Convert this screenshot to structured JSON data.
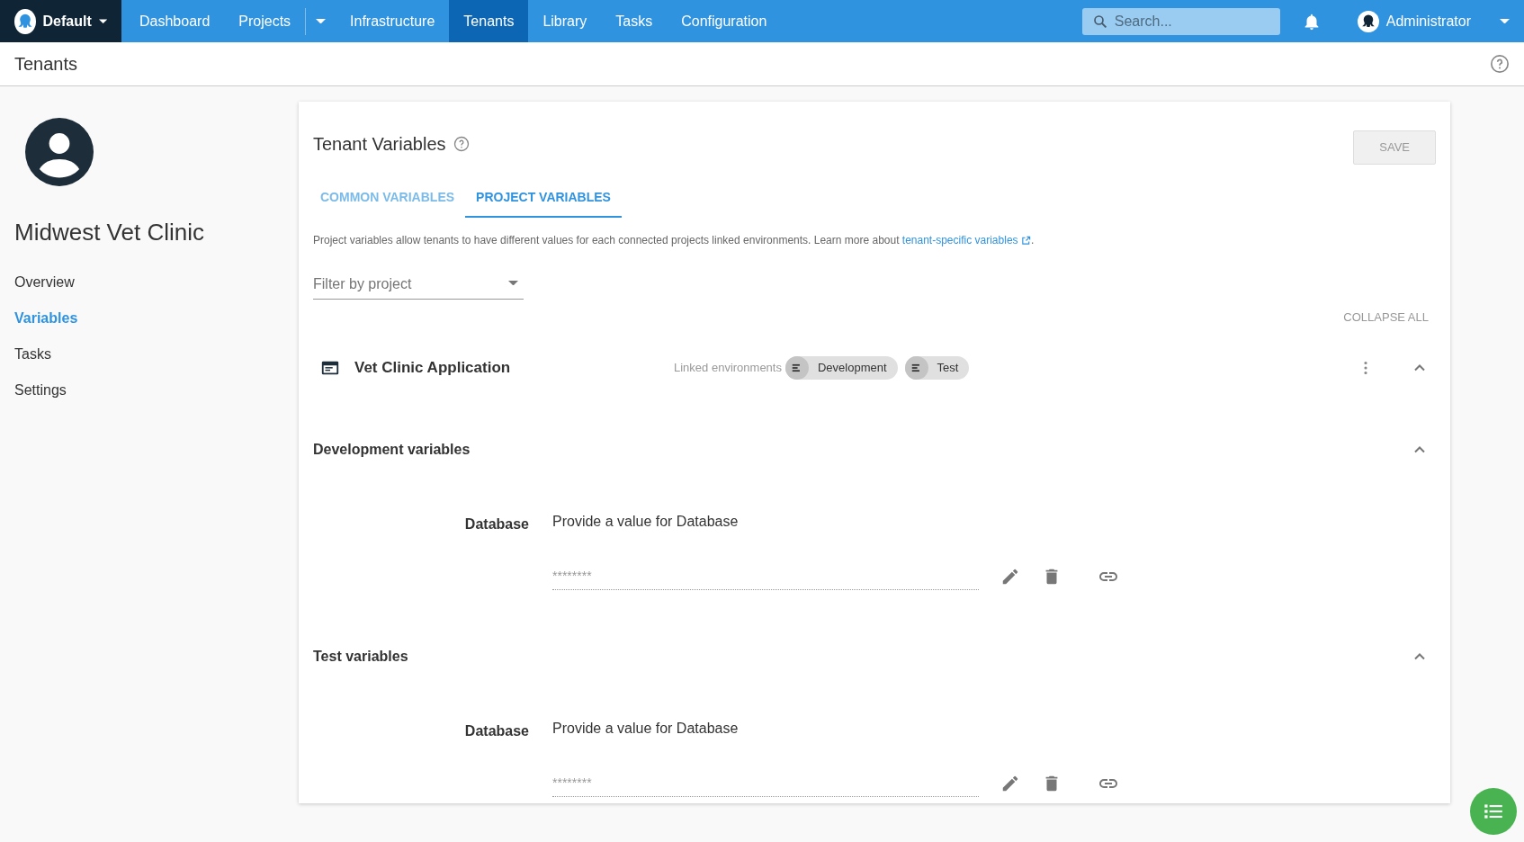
{
  "navbar": {
    "space": "Default",
    "items": [
      {
        "label": "Dashboard",
        "selected": false,
        "dropdown": false
      },
      {
        "label": "Projects",
        "selected": false,
        "dropdown": true
      },
      {
        "label": "Infrastructure",
        "selected": false,
        "dropdown": false
      },
      {
        "label": "Tenants",
        "selected": true,
        "dropdown": false
      },
      {
        "label": "Library",
        "selected": false,
        "dropdown": false
      },
      {
        "label": "Tasks",
        "selected": false,
        "dropdown": false
      },
      {
        "label": "Configuration",
        "selected": false,
        "dropdown": false
      }
    ],
    "search": {
      "placeholder": "Search..."
    },
    "user": "Administrator"
  },
  "page_title": "Tenants",
  "sidebar": {
    "tenant": "Midwest Vet Clinic",
    "items": [
      {
        "label": "Overview",
        "selected": false
      },
      {
        "label": "Variables",
        "selected": true
      },
      {
        "label": "Tasks",
        "selected": false
      },
      {
        "label": "Settings",
        "selected": false
      }
    ]
  },
  "panel": {
    "title": "Tenant Variables",
    "save": "SAVE",
    "save_disabled": true,
    "tabs": [
      {
        "label": "COMMON VARIABLES",
        "selected": false
      },
      {
        "label": "PROJECT VARIABLES",
        "selected": true
      }
    ],
    "description": "Project variables allow tenants to have different values for each connected projects linked environments. Learn more about ",
    "link": "tenant-specific variables",
    "description_end": ".",
    "filter": {
      "placeholder": "Filter by project"
    },
    "collapse_all": "COLLAPSE ALL",
    "project": {
      "name": "Vet Clinic Application",
      "linked_label": "Linked environments",
      "environments": [
        "Development",
        "Test"
      ],
      "expanded": true
    },
    "sections": [
      {
        "title": "Development variables",
        "expanded": true,
        "variables": [
          {
            "name": "Database",
            "hint": "Provide a value for Database",
            "placeholder": "********"
          }
        ]
      },
      {
        "title": "Test variables",
        "expanded": true,
        "variables": [
          {
            "name": "Database",
            "hint": "Provide a value for Database",
            "placeholder": "********"
          }
        ]
      }
    ]
  }
}
